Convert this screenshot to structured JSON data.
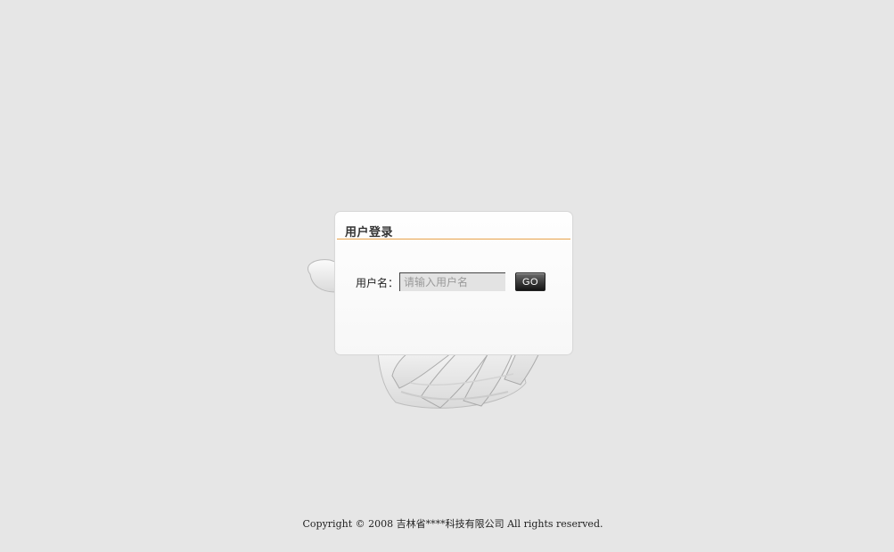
{
  "login": {
    "title": "用户登录",
    "username_label": "用户名：",
    "username_value": "",
    "username_placeholder": "请输入用户名",
    "go_label": "GO"
  },
  "footer": {
    "copyright": "Copyright © 2008 吉林省****科技有限公司 All rights reserved."
  },
  "colors": {
    "page_background": "#e6e6e6",
    "title_rule": "#e8a24a",
    "button_dark": "#151515"
  },
  "icons": {
    "hand": "hand-illustration"
  }
}
